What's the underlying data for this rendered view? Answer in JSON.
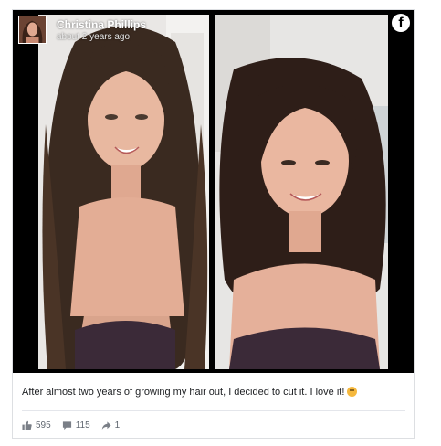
{
  "post": {
    "author_name": "Christina Phillips",
    "timestamp": "about 2 years ago",
    "caption": "After almost two years of growing my hair out, I decided to cut it. I love it!",
    "caption_emoji": "winking-face-emoji",
    "brand_icon": "facebook-logo-icon"
  },
  "stats": {
    "likes": "595",
    "comments": "115",
    "shares": "1"
  },
  "colors": {
    "media_background": "#000000",
    "caption_text": "#1c1e21",
    "stats_text": "#606770",
    "divider": "#e4e6eb"
  }
}
